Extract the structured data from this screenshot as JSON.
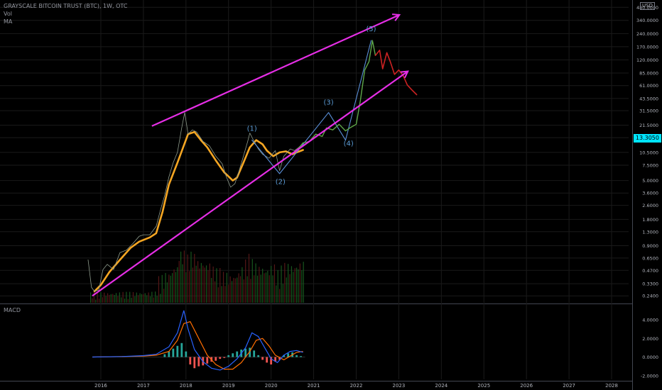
{
  "header": {
    "symbol": "GRAYSCALE BITCOIN TRUST (BTC), 1W, OTC",
    "volume_label": "Vol",
    "ma_label": "MA",
    "macd_label": "MACD",
    "scale_unit": "USD"
  },
  "colors": {
    "background": "#000000",
    "grid": "#1a1a1a",
    "ma_line": "#f5a623",
    "trend_lines": "#e62ee6",
    "projection_blue": "#5a8fd8",
    "projection_green": "#5fa84a",
    "projection_red": "#cc2222",
    "wave_labels": "#5b9bd5",
    "macd_line": "#2962ff",
    "signal_line": "#ff6d00",
    "hist_up": "#26a69a",
    "hist_down": "#ef5350",
    "current_price_bg": "#00e5ff"
  },
  "chart_data": {
    "type": "line",
    "title": "GRAYSCALE BITCOIN TRUST (BTC), 1W, OTC",
    "x_axis": {
      "ticks": [
        "2016",
        "2017",
        "2018",
        "2019",
        "2020",
        "2021",
        "2022",
        "2023",
        "2024",
        "2025",
        "2026",
        "2027",
        "2028"
      ],
      "range": [
        2015.6,
        2028.4
      ]
    },
    "y_axis": {
      "scale": "log",
      "ticks": [
        "480.0000",
        "340.0000",
        "240.0000",
        "170.0000",
        "120.0000",
        "85.0000",
        "61.0000",
        "43.5000",
        "31.5000",
        "21.5000",
        "15.5000",
        "10.5000",
        "7.5000",
        "5.0000",
        "3.6000",
        "2.6000",
        "1.8000",
        "1.3000",
        "0.9000",
        "0.6500",
        "0.4700",
        "0.3300",
        "0.2400"
      ],
      "range": [
        0.2,
        560
      ]
    },
    "current_price": "13.3050",
    "series": [
      {
        "kind": "moving-average",
        "x": [
          2015.85,
          2016.0,
          2016.2,
          2016.45,
          2016.7,
          2016.9,
          2017.15,
          2017.3,
          2017.45,
          2017.6,
          2017.8,
          2017.92,
          2018.05,
          2018.2,
          2018.35,
          2018.5,
          2018.7,
          2018.9,
          2019.1,
          2019.2,
          2019.35,
          2019.5,
          2019.65,
          2019.8,
          2019.9,
          2020.05,
          2020.2,
          2020.35,
          2020.5,
          2020.6,
          2020.75
        ],
        "y": [
          0.27,
          0.32,
          0.45,
          0.62,
          0.85,
          1.0,
          1.12,
          1.25,
          2.2,
          4.5,
          8.0,
          11.5,
          17.0,
          18.0,
          14.5,
          12.0,
          8.5,
          6.2,
          5.0,
          5.4,
          8.0,
          12.0,
          14.5,
          13.0,
          11.0,
          9.5,
          10.5,
          10.8,
          10.0,
          10.5,
          11.2
        ]
      },
      {
        "kind": "price",
        "x": [
          2015.7,
          2015.78,
          2015.85,
          2015.95,
          2016.05,
          2016.15,
          2016.3,
          2016.45,
          2016.6,
          2016.75,
          2016.9,
          2017.0,
          2017.15,
          2017.3,
          2017.4,
          2017.5,
          2017.6,
          2017.7,
          2017.8,
          2017.9,
          2017.97,
          2018.05,
          2018.15,
          2018.25,
          2018.4,
          2018.55,
          2018.7,
          2018.85,
          2018.95,
          2019.05,
          2019.15,
          2019.25,
          2019.35,
          2019.45,
          2019.5,
          2019.6,
          2019.7,
          2019.8,
          2019.95,
          2020.1,
          2020.2,
          2020.3,
          2020.45,
          2020.55,
          2020.65,
          2020.75
        ],
        "y": [
          0.62,
          0.3,
          0.27,
          0.28,
          0.48,
          0.55,
          0.48,
          0.75,
          0.8,
          0.95,
          1.15,
          1.2,
          1.2,
          1.5,
          2.3,
          3.4,
          5.5,
          8.0,
          10.5,
          20.0,
          30.0,
          17.0,
          19.0,
          18.0,
          14.0,
          12.5,
          9.5,
          7.8,
          5.5,
          4.2,
          4.6,
          6.5,
          9.5,
          14.0,
          17.5,
          14.0,
          11.5,
          10.0,
          9.0,
          11.0,
          6.5,
          9.5,
          11.5,
          11.0,
          12.0,
          13.3
        ]
      },
      {
        "kind": "wave-projection-blue",
        "x": [
          2019.55,
          2020.2,
          2021.35,
          2021.75,
          2022.35
        ],
        "y": [
          14.5,
          6.0,
          30.0,
          14.5,
          200
        ]
      },
      {
        "kind": "wave-projection-green",
        "x": [
          2020.6,
          2020.75,
          2020.9,
          2021.05,
          2021.2,
          2021.3,
          2021.45,
          2021.6,
          2021.75,
          2021.85,
          2022.0,
          2022.1,
          2022.2,
          2022.3,
          2022.38,
          2022.45
        ],
        "y": [
          11.0,
          13.5,
          14.0,
          17.0,
          16.0,
          20.0,
          19.0,
          22.0,
          18.5,
          20.0,
          22.0,
          42.0,
          92.0,
          115.0,
          200.0,
          135.0
        ]
      },
      {
        "kind": "wave-projection-red",
        "x": [
          2022.45,
          2022.55,
          2022.62,
          2022.72,
          2022.8,
          2022.9,
          2023.0,
          2023.1,
          2023.2,
          2023.3,
          2023.42
        ],
        "y": [
          135,
          155,
          95,
          145,
          115,
          82,
          92,
          80,
          62,
          55,
          48
        ]
      }
    ],
    "trend_lines": [
      {
        "name": "upper",
        "x": [
          2017.2,
          2023.0
        ],
        "y": [
          21.0,
          390.0
        ]
      },
      {
        "name": "lower",
        "x": [
          2015.8,
          2023.2
        ],
        "y": [
          0.24,
          88.0
        ]
      }
    ],
    "wave_labels": [
      {
        "text": "(1)",
        "x": 2019.55,
        "y": 18.5
      },
      {
        "text": "(2)",
        "x": 2020.22,
        "y": 4.55
      },
      {
        "text": "(3)",
        "x": 2021.35,
        "y": 37.0
      },
      {
        "text": "(4)",
        "x": 2021.82,
        "y": 12.5
      },
      {
        "text": "(5)",
        "x": 2022.35,
        "y": 255.0
      }
    ],
    "volume_note": "weekly volume bars along bottom of price pane",
    "macd": {
      "y_ticks": [
        "4.0000",
        "2.0000",
        "0.0000",
        "-2.0000"
      ],
      "y_range": [
        -2.4,
        5.6
      ],
      "macd_line": {
        "x": [
          2015.8,
          2016.5,
          2017.0,
          2017.3,
          2017.6,
          2017.8,
          2017.95,
          2018.05,
          2018.2,
          2018.4,
          2018.6,
          2018.8,
          2019.0,
          2019.2,
          2019.4,
          2019.55,
          2019.7,
          2019.85,
          2020.0,
          2020.15,
          2020.3,
          2020.45,
          2020.6,
          2020.75
        ],
        "y": [
          0.0,
          0.05,
          0.15,
          0.3,
          1.1,
          2.6,
          5.0,
          3.0,
          0.8,
          -0.5,
          -1.2,
          -1.4,
          -1.0,
          -0.2,
          1.0,
          2.6,
          2.2,
          1.0,
          -0.2,
          -0.6,
          0.2,
          0.6,
          0.7,
          0.5
        ]
      },
      "signal_line": {
        "x": [
          2015.8,
          2016.5,
          2017.0,
          2017.3,
          2017.6,
          2017.8,
          2017.95,
          2018.1,
          2018.3,
          2018.5,
          2018.7,
          2018.9,
          2019.1,
          2019.3,
          2019.5,
          2019.65,
          2019.8,
          2019.95,
          2020.1,
          2020.3,
          2020.45,
          2020.6,
          2020.75
        ],
        "y": [
          0.0,
          0.05,
          0.1,
          0.2,
          0.6,
          1.8,
          3.6,
          3.8,
          2.0,
          0.2,
          -0.8,
          -1.3,
          -1.3,
          -0.6,
          0.6,
          1.8,
          2.0,
          1.2,
          0.2,
          -0.3,
          0.1,
          0.5,
          0.6
        ]
      },
      "histogram": {
        "x": [
          2017.5,
          2017.6,
          2017.7,
          2017.8,
          2017.9,
          2018.0,
          2018.1,
          2018.2,
          2018.3,
          2018.4,
          2018.5,
          2018.6,
          2018.7,
          2018.8,
          2018.9,
          2019.0,
          2019.1,
          2019.2,
          2019.3,
          2019.4,
          2019.5,
          2019.6,
          2019.7,
          2019.8,
          2019.9,
          2020.0,
          2020.1,
          2020.2,
          2020.3,
          2020.4,
          2020.5,
          2020.6,
          2020.7
        ],
        "y": [
          0.3,
          0.6,
          0.9,
          1.2,
          1.5,
          0.6,
          -0.8,
          -1.2,
          -1.0,
          -0.9,
          -0.7,
          -0.5,
          -0.4,
          -0.2,
          -0.1,
          0.2,
          0.4,
          0.6,
          0.8,
          0.9,
          1.0,
          0.7,
          0.2,
          -0.3,
          -0.6,
          -0.8,
          -0.5,
          -0.3,
          0.2,
          0.4,
          0.5,
          0.2,
          0.1
        ]
      }
    }
  }
}
